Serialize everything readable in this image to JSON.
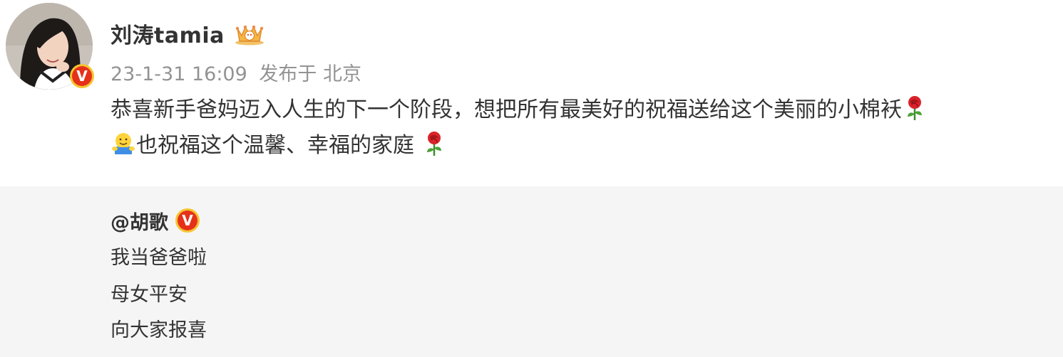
{
  "post": {
    "username": "刘涛tamia",
    "timestamp": "23-1-31 16:09",
    "source": "发布于 北京",
    "text_line1": "恭喜新手爸妈迈入人生的下一个阶段，想把所有最美好的祝福送给这个美丽的小棉袄",
    "text_line2": "也祝福这个温馨、幸福的家庭",
    "emojis": [
      "rose-emoji",
      "hug-emoji",
      "rose-emoji"
    ],
    "badge_icon": "verified-v-icon",
    "crown_icon": "crown-badge-icon",
    "badge_letter": "V",
    "colors": {
      "badge_red": "#e6311a",
      "badge_gold": "#f6c431",
      "meta_gray": "#939393",
      "text": "#333333",
      "repost_bg": "#f5f5f5"
    }
  },
  "repost": {
    "author": "@胡歌",
    "lines": [
      "我当爸爸啦",
      "母女平安",
      "向大家报喜"
    ]
  }
}
